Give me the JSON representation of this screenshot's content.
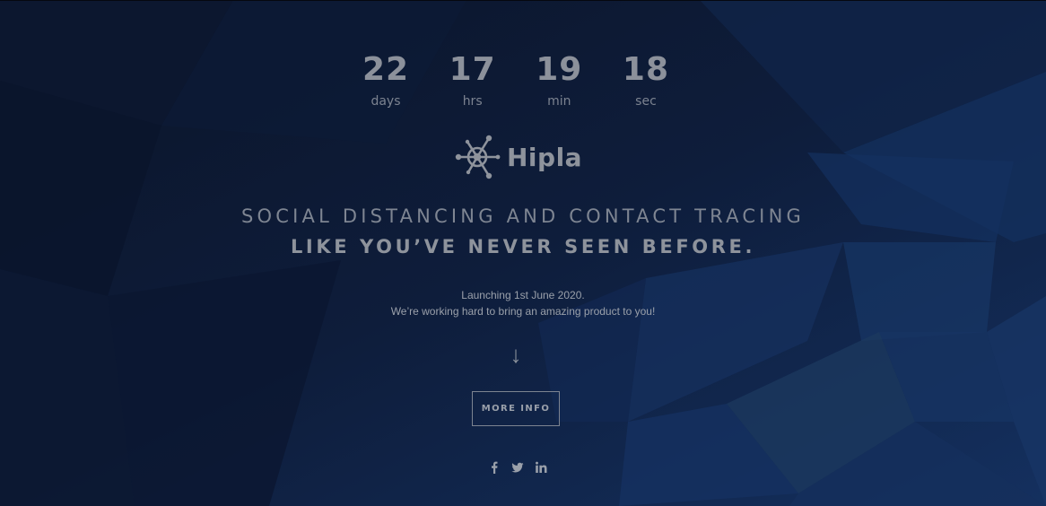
{
  "countdown": {
    "days": {
      "value": "22",
      "label": "days"
    },
    "hours": {
      "value": "17",
      "label": "hrs"
    },
    "minutes": {
      "value": "19",
      "label": "min"
    },
    "seconds": {
      "value": "18",
      "label": "sec"
    }
  },
  "logo": {
    "text": "Hipla",
    "icon": "hipla-logo-icon"
  },
  "headline": {
    "line1": "SOCIAL DISTANCING AND CONTACT TRACING",
    "line2": "LIKE YOU’VE NEVER SEEN BEFORE."
  },
  "launch": {
    "line1": "Launching 1st June 2020.",
    "line2": "We’re working hard to bring an amazing product to you!"
  },
  "scroll_arrow": {
    "glyph": "↓",
    "icon": "arrow-down-icon"
  },
  "more_info_button": {
    "label": "MORE INFO"
  },
  "social": [
    {
      "icon": "facebook-icon"
    },
    {
      "icon": "twitter-icon"
    },
    {
      "icon": "linkedin-icon"
    }
  ],
  "colors": {
    "background": "#0d1a33",
    "text": "#8f96a3",
    "accent_polygon": "#1c3a6e"
  }
}
